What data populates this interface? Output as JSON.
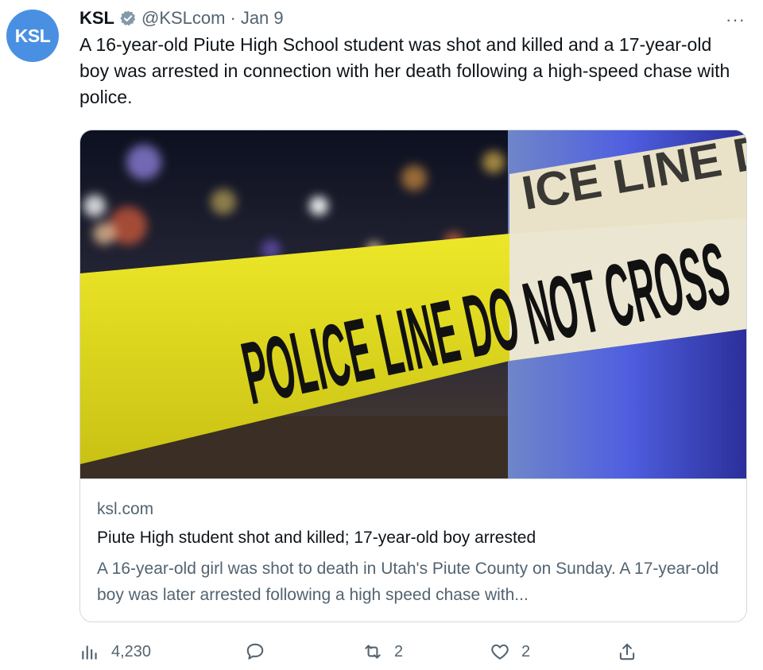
{
  "account": {
    "avatar_text": "KSL",
    "name": "KSL",
    "handle": "@KSLcom",
    "separator": "·",
    "date": "Jan 9",
    "more": "···"
  },
  "tweet": {
    "text": "A 16-year-old Piute High School student was shot and killed and a 17-year-old boy was arrested in connection with her death following a high-speed chase with police."
  },
  "card": {
    "image_icon": "police-tape-photo",
    "tape_text": "POLICE LINE DO NOT CROSS",
    "domain": "ksl.com",
    "title": "Piute High student shot and killed; 17-year-old boy arrested",
    "description": "A 16-year-old girl was shot to death in Utah's Piute County on Sunday. A 17-year-old boy was later arrested following a high speed chase with..."
  },
  "actions": {
    "views": "4,230",
    "reply": "",
    "retweets": "2",
    "likes": "2"
  },
  "colors": {
    "accent": "#4a90e2",
    "muted": "#536471",
    "tape": "#e6e016",
    "border": "#cfd9de"
  }
}
